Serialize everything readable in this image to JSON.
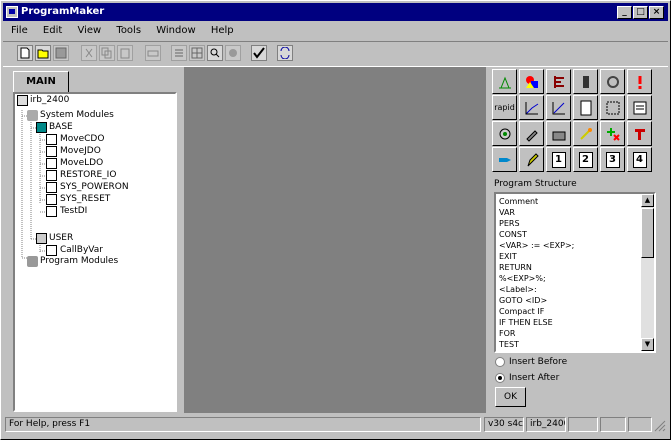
{
  "window": {
    "title": "ProgramMaker"
  },
  "menu": [
    "File",
    "Edit",
    "View",
    "Tools",
    "Window",
    "Help"
  ],
  "tree": {
    "tab": "MAIN",
    "root": "irb_2400",
    "system_modules": "System Modules",
    "base": "BASE",
    "base_items": [
      "MoveCDO",
      "MoveJDO",
      "MoveLDO",
      "RESTORE_IO",
      "SYS_POWERON",
      "SYS_RESET",
      "TestDI"
    ],
    "user": "USER",
    "user_items": [
      "CallByVar"
    ],
    "program_modules": "Program Modules"
  },
  "palette": {
    "rapid_label": "rapid",
    "numbers": [
      "1",
      "2",
      "3",
      "4"
    ]
  },
  "program_structure": {
    "label": "Program Structure",
    "items": [
      "Comment",
      "VAR",
      "PERS",
      "CONST",
      "<VAR> := <EXP>;",
      "EXIT",
      "RETURN",
      "%<EXP>%;",
      "<Label>:",
      "GOTO <ID>",
      "Compact IF",
      "IF THEN ELSE",
      "FOR",
      "TEST"
    ],
    "insert_before": "Insert Before",
    "insert_after": "Insert After",
    "ok": "OK"
  },
  "status": {
    "help": "For Help, press F1",
    "version": "v30 s4c",
    "robot": "irb_2400"
  }
}
